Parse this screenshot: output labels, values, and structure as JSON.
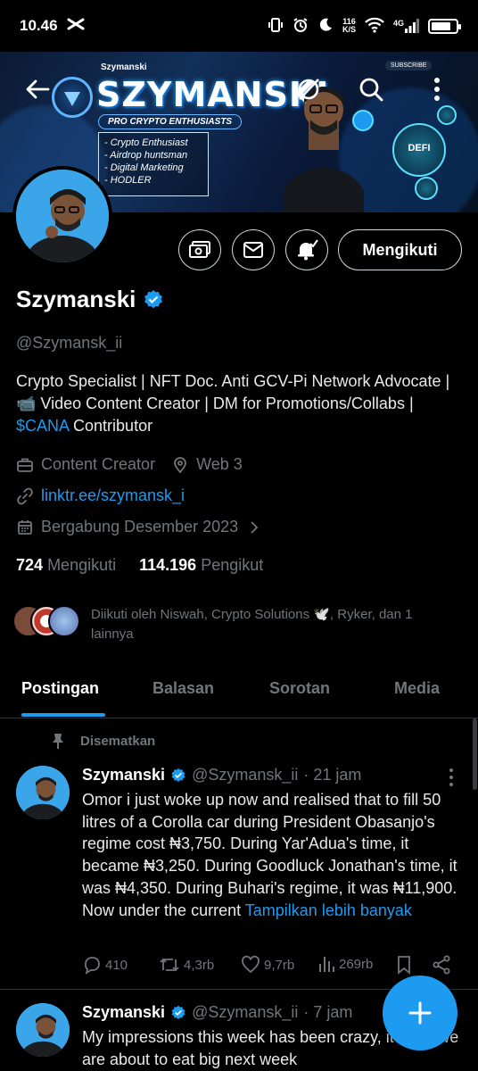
{
  "status_bar": {
    "time": "10.46",
    "net_speed_value": "116",
    "net_speed_unit": "K/S",
    "network": "4G"
  },
  "banner": {
    "brand_small": "Szymanski",
    "brand_big": "SZYMANSKI",
    "tagline": "PRO CRYPTO ENTHUSIASTS",
    "list": [
      "- Crypto Enthusiast",
      "- Airdrop huntsman",
      "- Digital Marketing",
      "- HODLER"
    ],
    "subscribe": "SUBSCRIBE",
    "coin_label": "DEFI"
  },
  "actions": {
    "follow_label": "Mengikuti"
  },
  "profile": {
    "name": "Szymanski",
    "handle": "@Szymansk_ii",
    "bio_part1": "Crypto Specialist | NFT Doc. Anti GCV-Pi Network Advocate | 📹 Video Content Creator | DM for Promotions/Collabs | ",
    "bio_cashtag": "$CANA",
    "bio_part2": " Contributor",
    "category": "Content Creator",
    "location": "Web 3",
    "link": "linktr.ee/szymansk_i",
    "joined": "Bergabung Desember 2023",
    "following_count": "724",
    "following_label": "Mengikuti",
    "followers_count": "114.196",
    "followers_label": "Pengikut",
    "followed_by": "Diikuti oleh Niswah, Crypto Solutions 🕊️, Ryker, dan 1 lainnya"
  },
  "tabs": [
    "Postingan",
    "Balasan",
    "Sorotan",
    "Media"
  ],
  "pinned_label": "Disematkan",
  "posts": [
    {
      "name": "Szymanski",
      "handle": "@Szymansk_ii",
      "time": "· 21 jam",
      "text": "Omor i just woke up now and realised that to fill 50 litres of a Corolla car during President Obasanjo's regime cost ₦3,750. During Yar'Adua's time, it became ₦3,250. During Goodluck Jonathan's time, it was ₦4,350. During Buhari's regime, it was ₦11,900. Now under the current ",
      "show_more": "Tampilkan lebih banyak",
      "replies": "410",
      "reposts": "4,3rb",
      "likes": "9,7rb",
      "views": "269rb"
    },
    {
      "name": "Szymanski",
      "handle": "@Szymansk_ii",
      "time": "· 7 jam",
      "text": "My impressions this week has been crazy, it's like we are about to eat big next week"
    }
  ]
}
